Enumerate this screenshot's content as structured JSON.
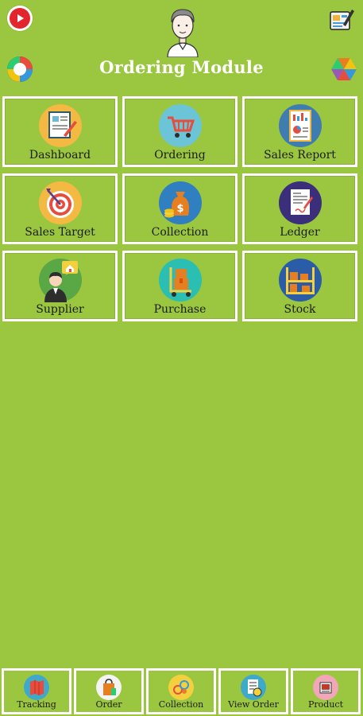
{
  "header": {
    "title": "Ordering Module",
    "left_top_icon": "youtube-play-icon",
    "center_icon": "user-avatar-icon",
    "right_top_icon": "edit-note-icon",
    "left_logo_icon": "brand-logo-icon",
    "right_logo_icon": "color-wheel-icon"
  },
  "tiles": [
    {
      "label": "Dashboard",
      "icon": "dashboard-icon"
    },
    {
      "label": "Ordering",
      "icon": "shopping-cart-icon"
    },
    {
      "label": "Sales Report",
      "icon": "report-icon"
    },
    {
      "label": "Sales Target",
      "icon": "target-icon"
    },
    {
      "label": "Collection",
      "icon": "money-bag-icon"
    },
    {
      "label": "Ledger",
      "icon": "ledger-icon"
    },
    {
      "label": "Supplier",
      "icon": "supplier-icon"
    },
    {
      "label": "Purchase",
      "icon": "purchase-icon"
    },
    {
      "label": "Stock",
      "icon": "stock-icon"
    }
  ],
  "bottom_nav": [
    {
      "label": "Tracking",
      "icon": "tracking-icon"
    },
    {
      "label": "Order",
      "icon": "order-icon"
    },
    {
      "label": "Collection",
      "icon": "collection-icon"
    },
    {
      "label": "View Order",
      "icon": "view-order-icon"
    },
    {
      "label": "Product",
      "icon": "product-icon"
    }
  ],
  "colors": {
    "background": "#9bc63f",
    "tile_border": "#ffffff",
    "title_text": "#ffffff"
  }
}
